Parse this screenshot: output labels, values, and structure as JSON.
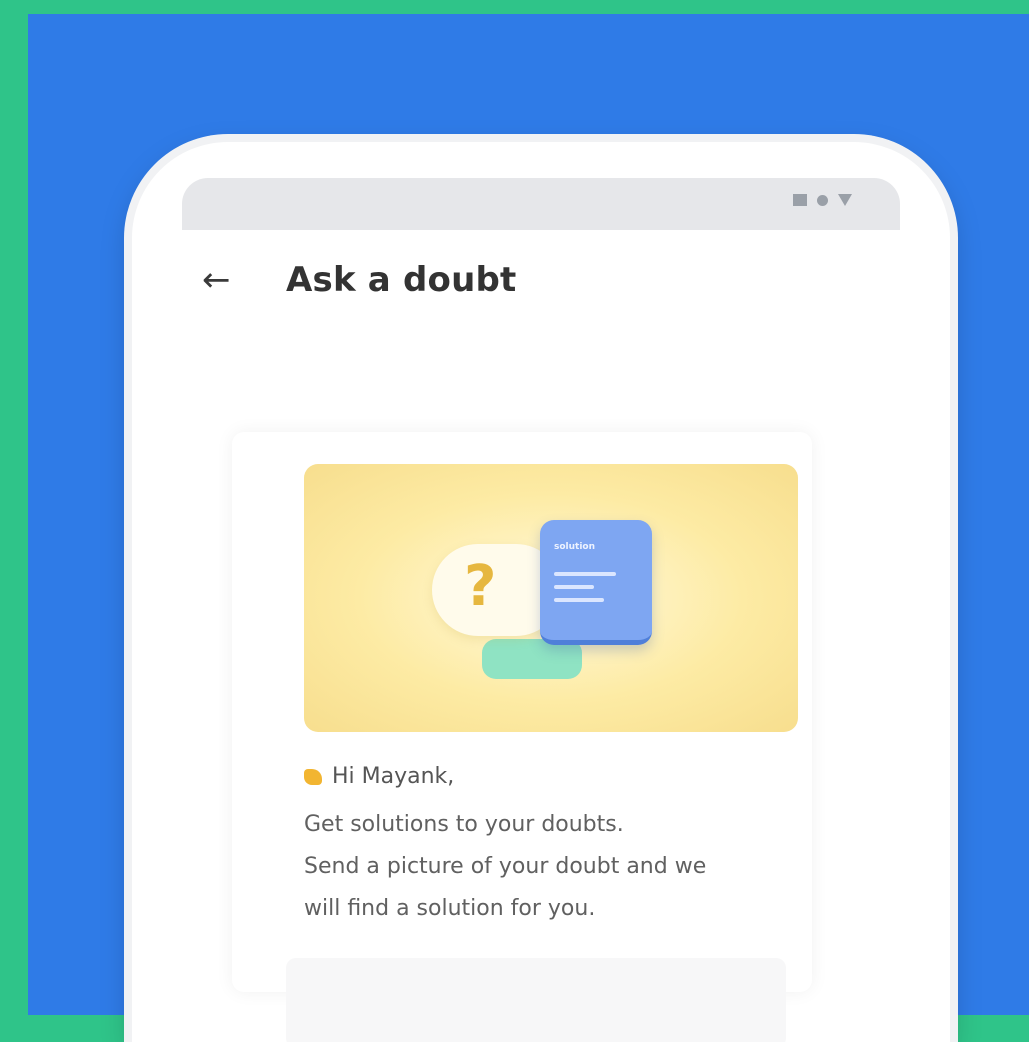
{
  "screen": {
    "title": "Ask a doubt",
    "back_icon": "arrow-left-icon",
    "status_icons": [
      "signal-square-icon",
      "dot-icon",
      "wifi-triangle-icon"
    ]
  },
  "illustration": {
    "question_glyph": "?",
    "solution_card_title": "solution"
  },
  "greeting": {
    "icon": "waving-hand-icon",
    "text": "Hi Mayank,"
  },
  "message_lines": [
    "Get solutions to your doubts.",
    "Send a picture of your doubt and we",
    "will find a solution for you."
  ],
  "colors": {
    "outer_background": "#2fc489",
    "panel_background": "#2f7be7",
    "illustration_background": "#fdeba4",
    "solution_card": "#7ea6f2"
  }
}
